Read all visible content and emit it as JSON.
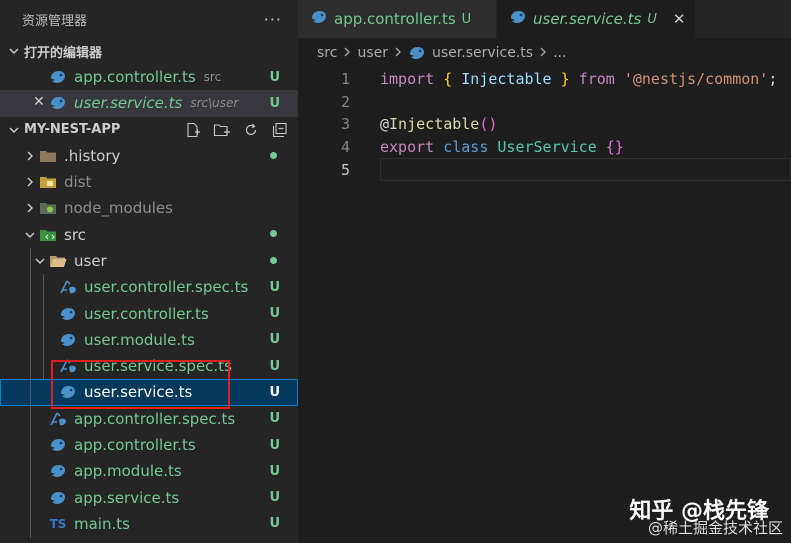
{
  "colors": {
    "accent": "#007fd4",
    "untracked": "#73c991",
    "highlight_box": "#e02020"
  },
  "sidebar": {
    "title": "资源管理器",
    "more_label": "···",
    "open_editors": {
      "title": "打开的编辑器",
      "items": [
        {
          "name": "app.controller.ts",
          "desc": "src",
          "status": "U",
          "icon": "nest-icon"
        },
        {
          "name": "user.service.ts",
          "desc": "src\\user",
          "status": "U",
          "icon": "nest-icon",
          "close": "✕"
        }
      ]
    },
    "project": {
      "title": "MY-NEST-APP",
      "items": [
        {
          "name": ".history",
          "kind": "folder",
          "icon": "folder-icon"
        },
        {
          "name": "dist",
          "kind": "folder",
          "icon": "folder-dist-icon"
        },
        {
          "name": "node_modules",
          "kind": "folder",
          "icon": "folder-node-icon"
        },
        {
          "name": "src",
          "kind": "folder",
          "icon": "folder-src-icon"
        },
        {
          "name": "user",
          "kind": "folder",
          "icon": "folder-open-icon"
        },
        {
          "name": "user.controller.spec.ts",
          "status": "U",
          "icon": "test-icon"
        },
        {
          "name": "user.controller.ts",
          "status": "U",
          "icon": "nest-icon"
        },
        {
          "name": "user.module.ts",
          "status": "U",
          "icon": "nest-icon"
        },
        {
          "name": "user.service.spec.ts",
          "status": "U",
          "icon": "test-icon"
        },
        {
          "name": "user.service.ts",
          "status": "U",
          "icon": "nest-icon"
        },
        {
          "name": "app.controller.spec.ts",
          "status": "U",
          "icon": "test-icon"
        },
        {
          "name": "app.controller.ts",
          "status": "U",
          "icon": "nest-icon"
        },
        {
          "name": "app.module.ts",
          "status": "U",
          "icon": "nest-icon"
        },
        {
          "name": "app.service.ts",
          "status": "U",
          "icon": "nest-icon"
        },
        {
          "name": "main.ts",
          "status": "U",
          "icon": "ts-icon",
          "icon_text": "TS"
        }
      ]
    }
  },
  "editor": {
    "tabs": [
      {
        "name": "app.controller.ts",
        "status": "U"
      },
      {
        "name": "user.service.ts",
        "status": "U",
        "close": "✕"
      }
    ],
    "breadcrumb": [
      "src",
      "user",
      "user.service.ts",
      "..."
    ],
    "lines": [
      {
        "num": "1",
        "tokens": [
          [
            "kw",
            "import"
          ],
          [
            "p",
            " "
          ],
          [
            "br",
            "{"
          ],
          [
            "p",
            " "
          ],
          [
            "id",
            "Injectable"
          ],
          [
            "p",
            " "
          ],
          [
            "br",
            "}"
          ],
          [
            "p",
            " "
          ],
          [
            "kw",
            "from"
          ],
          [
            "p",
            " "
          ],
          [
            "str",
            "'@nestjs/common'"
          ],
          [
            "p",
            ";"
          ]
        ]
      },
      {
        "num": "2",
        "tokens": []
      },
      {
        "num": "3",
        "tokens": [
          [
            "p",
            "@"
          ],
          [
            "fn",
            "Injectable"
          ],
          [
            "br2",
            "()"
          ]
        ]
      },
      {
        "num": "4",
        "tokens": [
          [
            "kw",
            "export"
          ],
          [
            "p",
            " "
          ],
          [
            "kw2",
            "class"
          ],
          [
            "p",
            " "
          ],
          [
            "cls",
            "UserService"
          ],
          [
            "p",
            " "
          ],
          [
            "br2",
            "{}"
          ]
        ]
      },
      {
        "num": "5",
        "tokens": []
      }
    ]
  },
  "watermark": {
    "main": "知乎 @栈先锋",
    "sub": "@稀土掘金技术社区"
  }
}
